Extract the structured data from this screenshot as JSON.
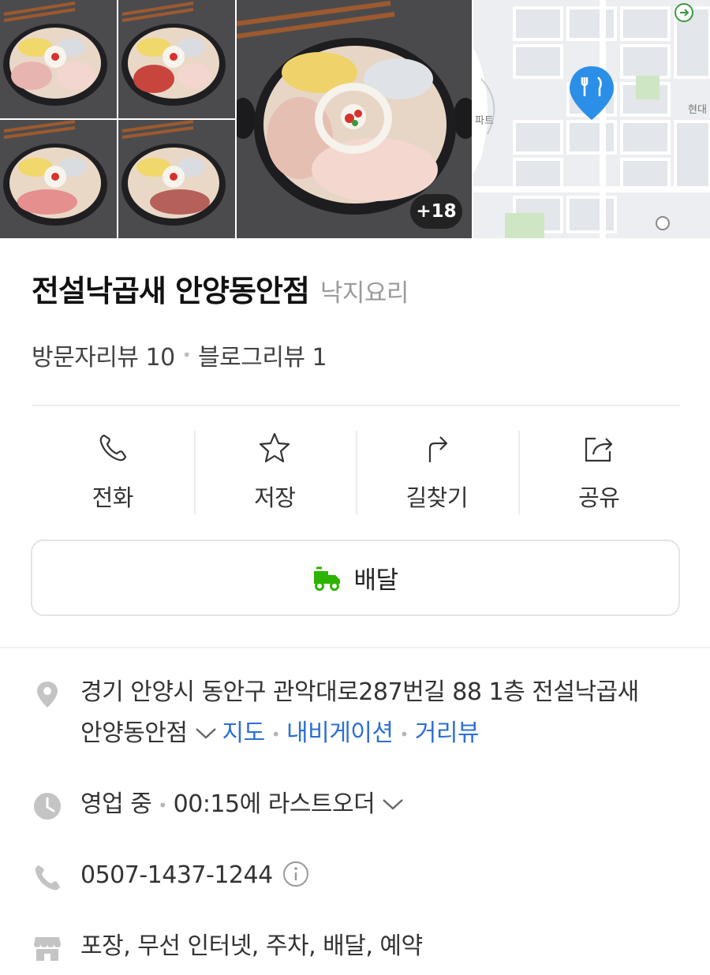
{
  "gallery": {
    "more_count": "+18",
    "photos": [
      "food-photo-1",
      "food-photo-2",
      "food-photo-3",
      "food-photo-4",
      "food-photo-main"
    ]
  },
  "map": {
    "pin_icon": "restaurant-pin-icon",
    "labels": {
      "left": "파트",
      "right": "현대"
    }
  },
  "place": {
    "name": "전설낙곱새 안양동안점",
    "category": "낙지요리",
    "visitor_reviews": "방문자리뷰 10",
    "blog_reviews": "블로그리뷰 1",
    "review_separator": "•"
  },
  "actions": [
    {
      "label": "전화",
      "icon": "phone-icon"
    },
    {
      "label": "저장",
      "icon": "star-icon"
    },
    {
      "label": "길찾기",
      "icon": "directions-icon"
    },
    {
      "label": "공유",
      "icon": "share-icon"
    }
  ],
  "delivery": {
    "label": "배달",
    "icon": "delivery-truck-icon",
    "icon_color": "#2db400"
  },
  "info": {
    "address": "경기 안양시 동안구 관악대로287번길 88 1층 전설낙곱새 안양동안점",
    "address_links": [
      "지도",
      "내비게이션",
      "거리뷰"
    ],
    "status": "영업 중",
    "last_order": "00:15에 라스트오더",
    "phone": "0507-1437-1244",
    "amenities": "포장, 무선 인터넷, 주차, 배달, 예약"
  },
  "colors": {
    "link": "#2d6fd3",
    "icon_gray": "#c4c4c4",
    "pin_blue": "#2b8fe8"
  }
}
